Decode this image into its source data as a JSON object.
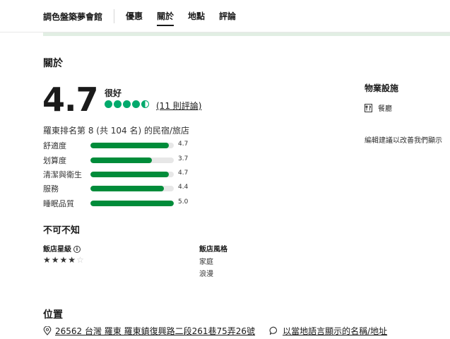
{
  "nav": {
    "hotel_name": "調色盤築夢會館",
    "tabs": [
      "優惠",
      "關於",
      "地點",
      "評論"
    ]
  },
  "about": {
    "title": "關於",
    "score": "4.7",
    "score_label": "很好",
    "bubble_rating": 4.5,
    "reviews_link": "(11 則評論)",
    "rank_text": "羅東排名第 8 (共 104 名) 的民宿/旅店",
    "ratings": [
      {
        "name": "舒適度",
        "value": "4.7",
        "fraction": 0.94
      },
      {
        "name": "划算度",
        "value": "3.7",
        "fraction": 0.74
      },
      {
        "name": "清潔與衛生",
        "value": "4.7",
        "fraction": 0.94
      },
      {
        "name": "服務",
        "value": "4.4",
        "fraction": 0.88
      },
      {
        "name": "睡眠品質",
        "value": "5.0",
        "fraction": 1.0
      }
    ]
  },
  "facilities": {
    "title": "物業設施",
    "items": [
      {
        "icon": "restaurant-icon",
        "label": "餐廳"
      }
    ],
    "suggest_text": "編輯建議以改善我們顯示"
  },
  "good_to_know": {
    "title": "不可不知",
    "star_label": "飯店星級",
    "stars": 4,
    "stars_max": 5,
    "style_label": "飯店風格",
    "styles": [
      "家庭",
      "浪漫"
    ]
  },
  "location": {
    "title": "位置",
    "address": "26562 台灣 羅東 羅東鎮復興路二段261巷75弄26號",
    "local_link": "以當地語言顯示的名稱/地址"
  },
  "colors": {
    "accent_green": "#00aa6c",
    "bar_green": "#008c3a"
  }
}
